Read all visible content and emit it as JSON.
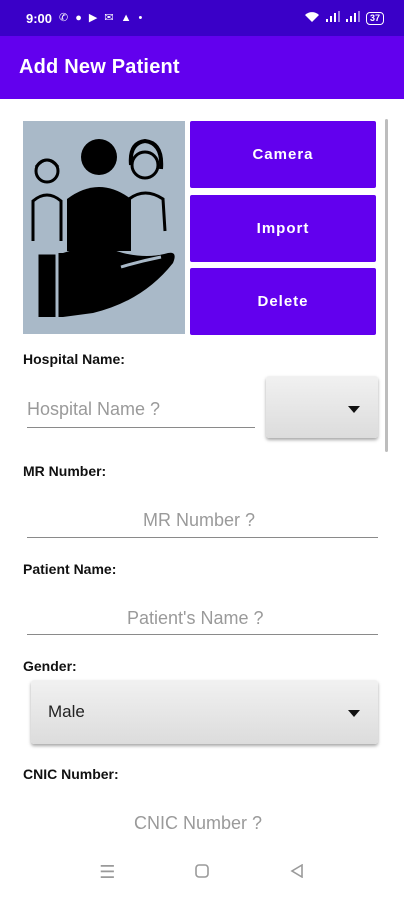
{
  "status_bar": {
    "time": "9:00",
    "battery": "37",
    "icons": [
      "whatsapp-icon",
      "chat-icon",
      "youtube-icon",
      "gmail-icon",
      "notification-bell-icon",
      "dot-icon",
      "wifi-icon",
      "signal-icon",
      "signal-icon",
      "battery-icon"
    ]
  },
  "app_bar": {
    "title": "Add New Patient",
    "background": "#6200ee"
  },
  "photo_actions": {
    "camera_label": "Camera",
    "import_label": "Import",
    "delete_label": "Delete"
  },
  "form": {
    "hospital": {
      "label": "Hospital Name:",
      "placeholder": "Hospital Name ?"
    },
    "mr": {
      "label": "MR Number:",
      "placeholder": "MR Number ?"
    },
    "patient": {
      "label": "Patient Name:",
      "placeholder": "Patient's Name ?"
    },
    "gender": {
      "label": "Gender:",
      "selected": "Male"
    },
    "cnic": {
      "label": "CNIC Number:",
      "placeholder": "CNIC Number ?"
    }
  },
  "nav_bar": {
    "icons": [
      "menu-icon",
      "home-icon",
      "back-icon"
    ]
  },
  "colors": {
    "primary": "#6200ee",
    "status_bar": "#3a00c8",
    "photo_bg": "#a9b9c8"
  }
}
